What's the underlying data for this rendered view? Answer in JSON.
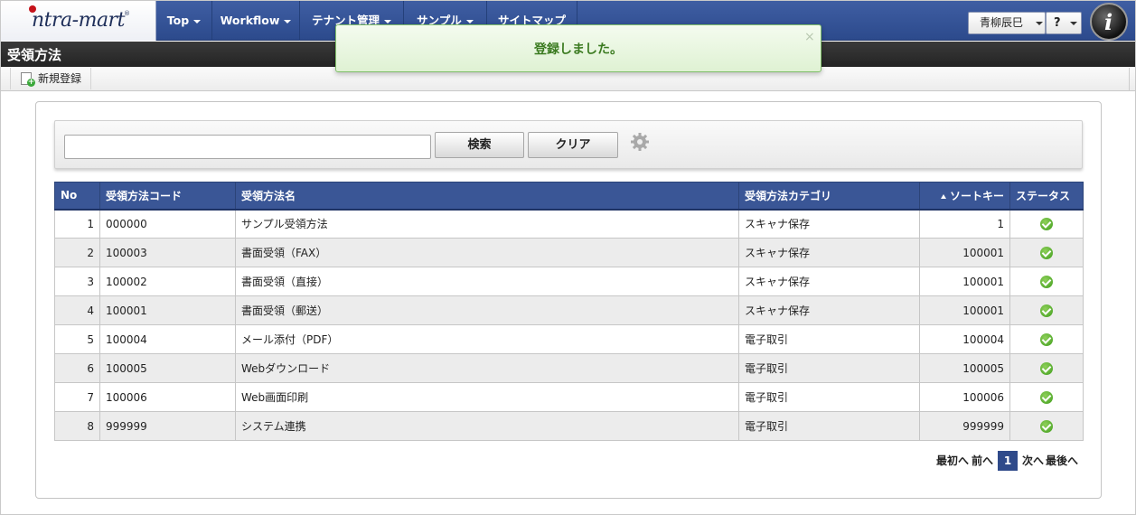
{
  "logo": {
    "text": "ntra-mart",
    "reg": "®"
  },
  "nav": {
    "items": [
      "Top",
      "Workflow",
      "テナント管理",
      "サンプル",
      "サイトマップ"
    ],
    "user": "青柳辰巳",
    "help": "?"
  },
  "brand_letter": "i",
  "page": {
    "title": "受領方法"
  },
  "toolbar": {
    "new_label": "新規登録"
  },
  "toast": {
    "message": "登録しました。",
    "close": "×"
  },
  "search": {
    "value": "",
    "placeholder": "",
    "search_button": "検索",
    "clear_button": "クリア"
  },
  "table": {
    "headers": [
      "No",
      "受領方法コード",
      "受領方法名",
      "受領方法カテゴリ",
      "ソートキー",
      "ステータス"
    ],
    "rows": [
      {
        "no": "1",
        "code": "000000",
        "name": "サンプル受領方法",
        "category": "スキャナ保存",
        "sort": "1"
      },
      {
        "no": "2",
        "code": "100003",
        "name": "書面受領（FAX）",
        "category": "スキャナ保存",
        "sort": "100001"
      },
      {
        "no": "3",
        "code": "100002",
        "name": "書面受領（直接）",
        "category": "スキャナ保存",
        "sort": "100001"
      },
      {
        "no": "4",
        "code": "100001",
        "name": "書面受領（郵送）",
        "category": "スキャナ保存",
        "sort": "100001"
      },
      {
        "no": "5",
        "code": "100004",
        "name": "メール添付（PDF）",
        "category": "電子取引",
        "sort": "100004"
      },
      {
        "no": "6",
        "code": "100005",
        "name": "Webダウンロード",
        "category": "電子取引",
        "sort": "100005"
      },
      {
        "no": "7",
        "code": "100006",
        "name": "Web画面印刷",
        "category": "電子取引",
        "sort": "100006"
      },
      {
        "no": "8",
        "code": "999999",
        "name": "システム連携",
        "category": "電子取引",
        "sort": "999999"
      }
    ]
  },
  "pager": {
    "first": "最初へ",
    "prev": "前へ",
    "current": "1",
    "next": "次へ",
    "last": "最後へ"
  },
  "colors": {
    "nav": "#2c4a8c",
    "header": "#3a5696",
    "toast_text": "#3a7a1f",
    "status_ok": "#3f9d1c"
  }
}
